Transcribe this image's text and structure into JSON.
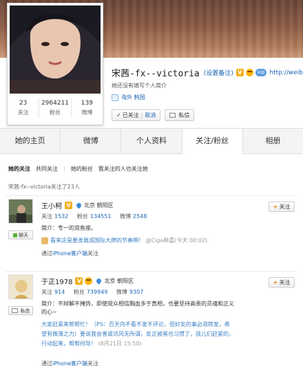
{
  "profile": {
    "name": "宋茜-fx--victoria",
    "remark_label": "(设置备注)",
    "url": "http://weibo.",
    "vip_label": "vip",
    "bio": "她还没有填写个人简介",
    "location": "海外 韩国",
    "stats": [
      {
        "num": "23",
        "label": "关注"
      },
      {
        "num": "2964211",
        "label": "粉丝"
      },
      {
        "num": "139",
        "label": "微博"
      }
    ],
    "followed_label": "已关注",
    "cancel_label": "取消",
    "message_label": "私信"
  },
  "tabs": [
    "她的主页",
    "微博",
    "个人资料",
    "关注/粉丝",
    "相册"
  ],
  "subtabs": {
    "following": "她的关注",
    "mutual": "共同关注",
    "fans": "她的粉丝",
    "also_following": "我关注的人也关注她"
  },
  "count_text": "宋茜-fx--victoria关注了23人",
  "users": [
    {
      "name": "王小柯",
      "location": "北京 朝阳区",
      "follow": "关注",
      "follow_n": "1532",
      "fans": "粉丝",
      "fans_n": "134551",
      "weibo": "微博",
      "weibo_n": "2548",
      "intro": "简介：专一的双鱼座。",
      "post": "看来这是要发展成国际大牌的节奏啊！",
      "post_meta": "@Ciga粹嘉(今天 00:02)",
      "via_prefix": "通过",
      "via_link": "iPhone客户端",
      "via_suffix": "关注",
      "action": "聊天",
      "follow_btn": "关注"
    },
    {
      "name": "于正1978",
      "location": "北京 朝阳区",
      "follow": "关注",
      "follow_n": "914",
      "fans": "粉丝",
      "fans_n": "739949",
      "weibo": "微博",
      "weibo_n": "9307",
      "intro_1": "简介：不辩解不掩饰，即使观众相信胸血多于真相，也要坚持高贵的灵魂和正义",
      "intro_2": "的心~",
      "post_1": "大家赶紧来帮帮忙！（PS：百天内不看不发不评论，但好友的事必须转发，希",
      "post_2": "望有微薄之力）要说我会害或讯风无所谓，反正被黑也习惯了，孩儿们赶紧的，",
      "post_3": "行动起来，帮帮何导！",
      "post_meta": "(8月21日 15:50)",
      "via_prefix": "通过",
      "via_link": "iPhone客户端",
      "via_suffix": "关注",
      "action": "私信",
      "follow_btn": "关注"
    }
  ]
}
